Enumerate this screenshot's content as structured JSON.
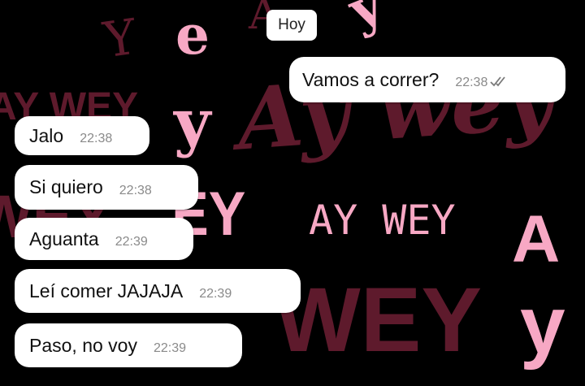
{
  "chat": {
    "date_label": "Hoy",
    "messages": [
      {
        "direction": "outgoing",
        "text": "Vamos a correr?",
        "time": "22:38",
        "status": "read-double-check"
      },
      {
        "direction": "incoming",
        "text": "Jalo",
        "time": "22:38"
      },
      {
        "direction": "incoming",
        "text": "Si quiero",
        "time": "22:38"
      },
      {
        "direction": "incoming",
        "text": "Aguanta",
        "time": "22:39"
      },
      {
        "direction": "incoming",
        "text": "Leí comer JAJAJA",
        "time": "22:39"
      },
      {
        "direction": "incoming",
        "text": "Paso, no voy",
        "time": "22:39"
      }
    ]
  },
  "wallpaper": {
    "texts": [
      "Y",
      "e",
      "A",
      "y",
      "Ay wey",
      "y",
      "AY WEY",
      "EY",
      "AY WEY",
      "A",
      "WEY",
      "y",
      "WEY"
    ],
    "colors": {
      "pink": "#f7a8c4",
      "maroon": "#5e1a2c",
      "background": "#000000"
    }
  },
  "colors": {
    "bubble": "#ffffff",
    "text": "#111111",
    "timestamp": "#8a8a8a",
    "tick": "#7a7a7a"
  }
}
